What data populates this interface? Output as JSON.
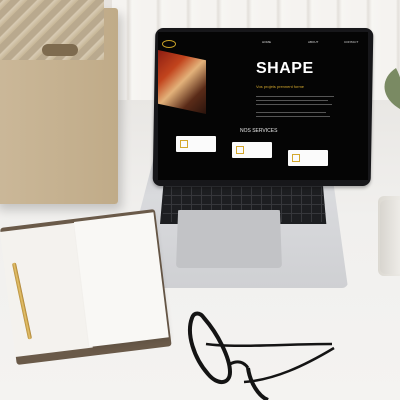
{
  "screen": {
    "nav_items": [
      "HOME",
      "ABOUT",
      "CONTACT"
    ],
    "title": "SHAPE",
    "subtitle": "Vos projets prennent forme",
    "services_heading": "NOS SERVICES"
  },
  "scene_objects": {
    "icons": [
      "logo-icon",
      "service-icon"
    ]
  },
  "colors": {
    "accent": "#d4a82d",
    "screen_bg": "#050505",
    "laptop_body": "#c9cacd"
  }
}
